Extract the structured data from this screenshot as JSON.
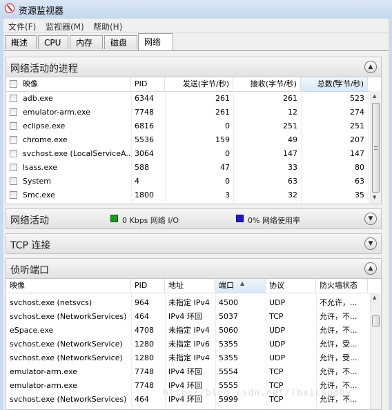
{
  "window": {
    "title": "资源监视器"
  },
  "menu": [
    "文件(F)",
    "监视器(M)",
    "帮助(H)"
  ],
  "tabs": [
    "概述",
    "CPU",
    "内存",
    "磁盘",
    "网络"
  ],
  "active_tab": "网络",
  "processes": {
    "title": "网络活动的进程",
    "columns": [
      "映像",
      "PID",
      "发送(字节/秒)",
      "接收(字节/秒)",
      "总数(字节/秒)"
    ],
    "rows": [
      [
        "adb.exe",
        "6344",
        "261",
        "261",
        "523"
      ],
      [
        "emulator-arm.exe",
        "7748",
        "261",
        "12",
        "274"
      ],
      [
        "eclipse.exe",
        "6816",
        "0",
        "251",
        "251"
      ],
      [
        "chrome.exe",
        "5536",
        "159",
        "49",
        "207"
      ],
      [
        "svchost.exe (LocalServiceA...",
        "3064",
        "0",
        "147",
        "147"
      ],
      [
        "lsass.exe",
        "588",
        "47",
        "33",
        "80"
      ],
      [
        "System",
        "4",
        "0",
        "63",
        "63"
      ],
      [
        "Smc.exe",
        "1800",
        "3",
        "32",
        "35"
      ]
    ]
  },
  "network_activity": {
    "title": "网络活动",
    "io_label": "0 Kbps 网络 I/O",
    "usage_label": "0% 网络使用率",
    "io_color": "#1a9a1a",
    "usage_color": "#1a1acc"
  },
  "tcp": {
    "title": "TCP 连接"
  },
  "listening": {
    "title": "侦听端口",
    "columns": [
      "映像",
      "PID",
      "地址",
      "端口",
      "协议",
      "防火墙状态"
    ],
    "rows": [
      [
        "svchost.exe (netsvcs)",
        "964",
        "未指定 IPv4",
        "4500",
        "UDP",
        "不允许，..."
      ],
      [
        "svchost.exe (NetworkServices)",
        "464",
        "IPv4 环回",
        "5037",
        "TCP",
        "允许，不..."
      ],
      [
        "eSpace.exe",
        "4708",
        "未指定 IPv4",
        "5060",
        "UDP",
        "允许，不..."
      ],
      [
        "svchost.exe (NetworkService)",
        "1280",
        "未指定 IPv6",
        "5355",
        "UDP",
        "允许，受..."
      ],
      [
        "svchost.exe (NetworkService)",
        "1280",
        "未指定 IPv4",
        "5355",
        "UDP",
        "允许，受..."
      ],
      [
        "emulator-arm.exe",
        "7748",
        "IPv4 环回",
        "5554",
        "TCP",
        "允许，不..."
      ],
      [
        "emulator-arm.exe",
        "7748",
        "IPv4 环回",
        "5555",
        "TCP",
        "允许，不..."
      ],
      [
        "svchost.exe (NetworkServices)",
        "464",
        "IPv4 环回",
        "5999",
        "TCP",
        "允许，不..."
      ]
    ]
  },
  "watermark": "http://blog.csdn.net/lbxicsophy"
}
